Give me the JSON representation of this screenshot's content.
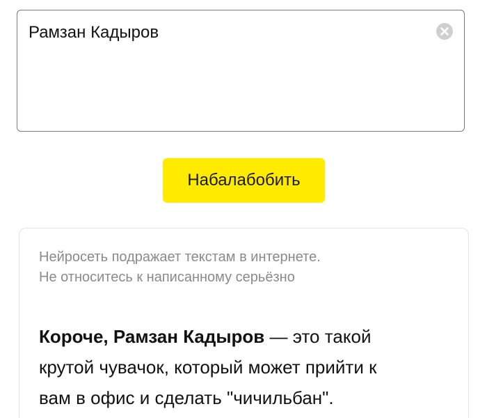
{
  "prompt": {
    "value": "Рамзан Кадыров",
    "clear_icon": "clear-x-circle-icon"
  },
  "generate_button": {
    "label": "Набалабобить",
    "color": "#ffeb00"
  },
  "result": {
    "disclaimer_lines": [
      "Нейросеть подражает текстам в интернете.",
      "Не относитесь к написанному серьёзно"
    ],
    "lead_bold": "Короче, Рамзан Кадыров",
    "lines": [
      " — это такой",
      "крутой чувачок, который может прийти к",
      "вам в офис и сделать \"чичильбан\"."
    ]
  }
}
